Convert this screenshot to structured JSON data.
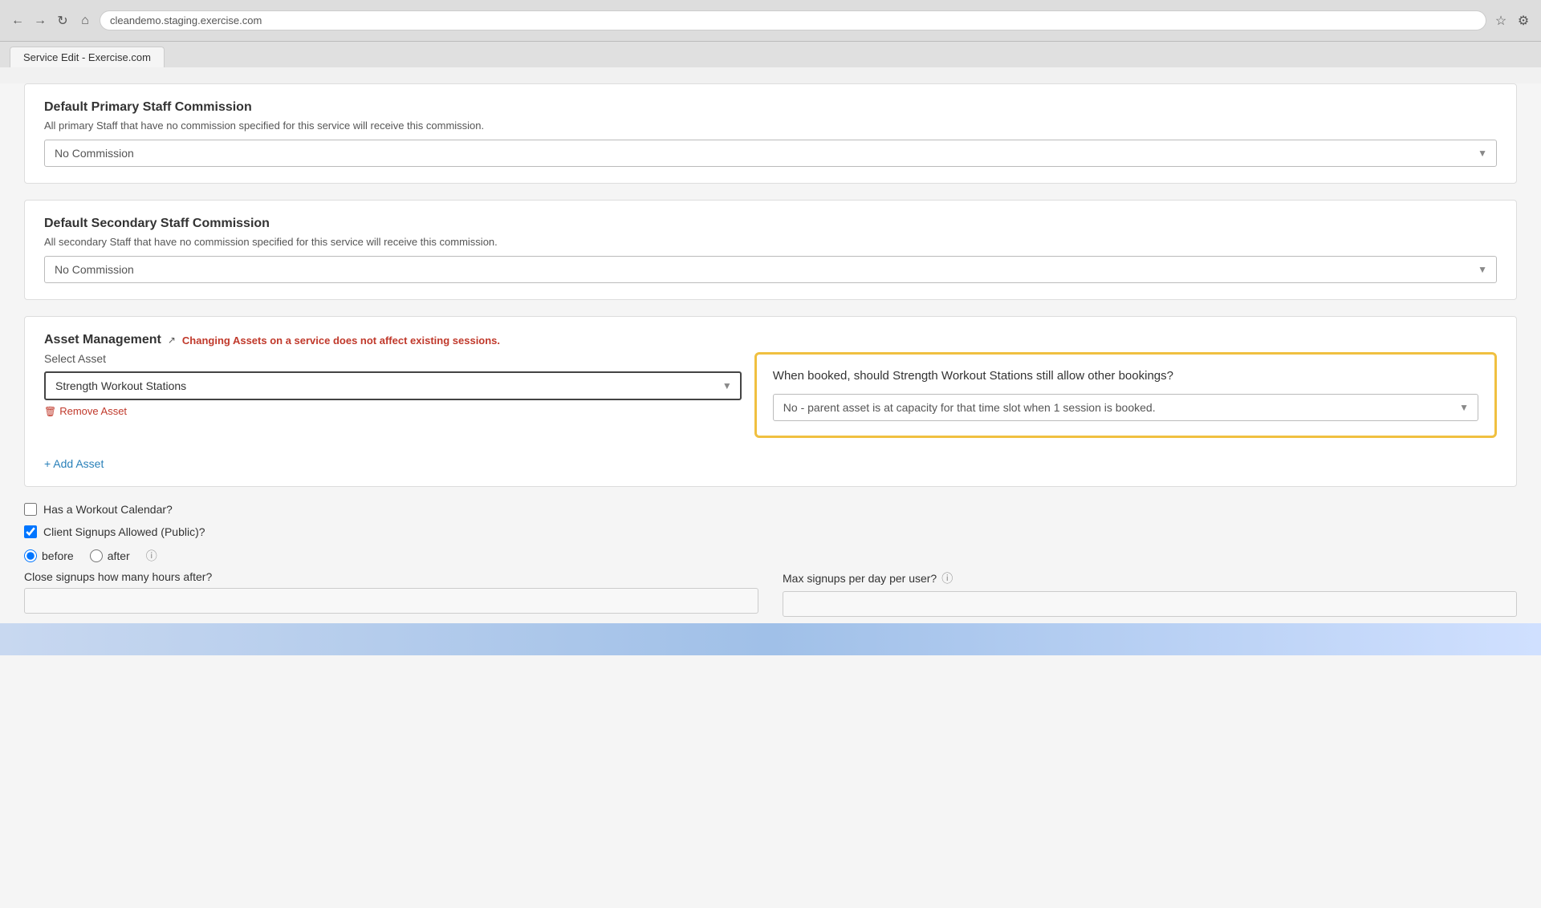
{
  "browser": {
    "url": "cleandemo.staging.exercise.com",
    "tab_label": "Service Edit - Exercise.com"
  },
  "page": {
    "primary_commission_section": {
      "title": "Default Primary Staff Commission",
      "description": "All primary Staff that have no commission specified for this service will receive this commission.",
      "dropdown_value": "No Commission",
      "dropdown_options": [
        "No Commission"
      ]
    },
    "secondary_commission_section": {
      "title": "Default Secondary Staff Commission",
      "description": "All secondary Staff that have no commission specified for this service will receive this commission.",
      "dropdown_value": "No Commission",
      "dropdown_options": [
        "No Commission"
      ]
    },
    "asset_management": {
      "title": "Asset Management",
      "warning_text": "Changing Assets on a service does not affect existing sessions.",
      "select_asset_label": "Select Asset",
      "asset_selected": "Strength Workout Stations",
      "remove_asset_label": "Remove Asset",
      "add_asset_label": "+ Add Asset",
      "booking_question": "When booked, should Strength Workout Stations still allow other bookings?",
      "booking_answer": "No - parent asset is at capacity for that time slot when 1 session is booked.",
      "booking_answer_options": [
        "No - parent asset is at capacity for that time slot when 1 session is booked."
      ]
    },
    "workout_calendar": {
      "label": "Has a Workout Calendar?",
      "checked": false
    },
    "client_signups": {
      "label": "Client Signups Allowed (Public)?",
      "checked": true
    },
    "signup_timing": {
      "before_label": "before",
      "after_label": "after",
      "help_available": true
    },
    "close_signups": {
      "label": "Close signups how many hours after?"
    },
    "max_signups": {
      "label": "Max signups per day per user?"
    }
  }
}
